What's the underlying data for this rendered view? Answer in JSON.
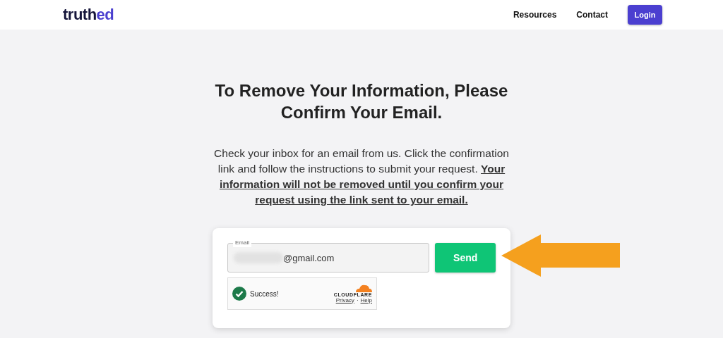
{
  "header": {
    "logo": {
      "text": "truth",
      "accent": "ed"
    },
    "nav": [
      "Resources",
      "Contact"
    ],
    "login_button": "Login"
  },
  "title": "To Remove Your Information, Please Confirm Your Email.",
  "message": "Check your inbox for an email from us. Click the confirmation link and follow the instructions to submit your request. **Your information will not be removed until you confirm your request using the link sent to your email.**",
  "form": {
    "email": {
      "label": "Email",
      "value": "@gmail.com",
      "redacted": true
    },
    "send_button": "Send",
    "captcha": {
      "status": "Success!",
      "success": true,
      "brand": "CLOUDFLARE",
      "links": [
        "Privacy",
        "Help"
      ],
      "separator": "·"
    }
  },
  "annotation": {
    "kind": "arrow"
  }
}
